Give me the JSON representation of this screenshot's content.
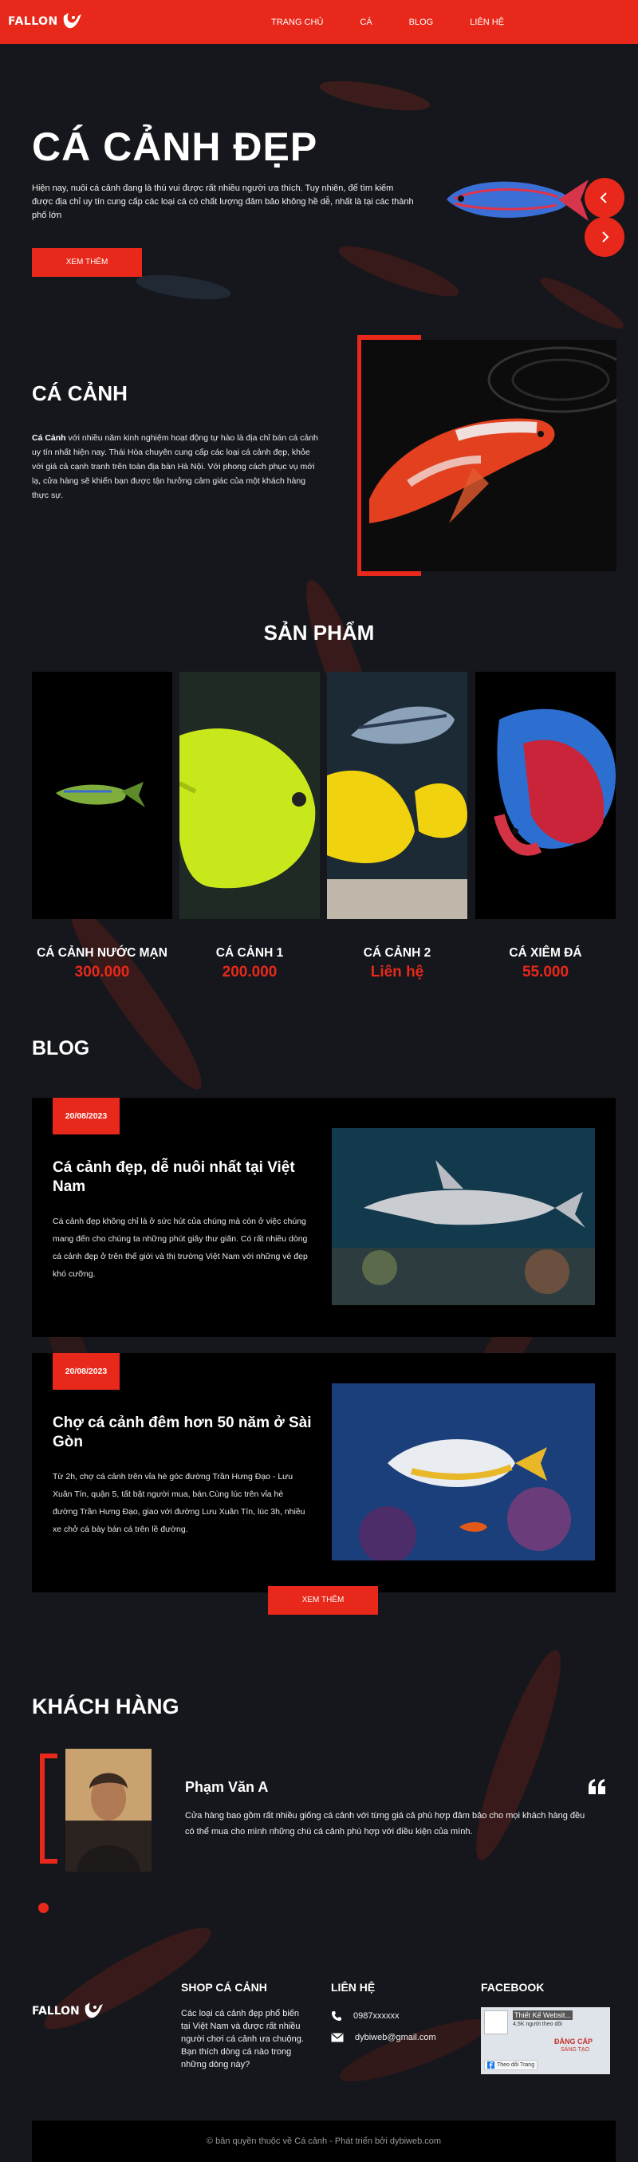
{
  "header": {
    "logo_text": "FALLON",
    "nav": [
      "TRANG CHỦ",
      "CÁ",
      "BLOG",
      "LIÊN HỆ"
    ]
  },
  "hero": {
    "title": "CÁ CẢNH ĐẸP",
    "description": "Hiện nay, nuôi cá cảnh đang là thú vui được rất nhiều người ưa thích. Tuy nhiên, để tìm kiếm được địa chỉ uy tín cung cấp các loại cá có chất lượng đảm bảo không hề dễ, nhất là tại các thành phố lớn",
    "button": "XEM THÊM",
    "prev_icon": "chevron-left-icon",
    "next_icon": "chevron-right-icon"
  },
  "about": {
    "title": "CÁ CẢNH",
    "text_bold": "Cá Cảnh",
    "text": " với nhiều năm kinh nghiệm hoạt động tự hào là địa chỉ bán cá cảnh uy tín nhất hiện nay. Thái Hòa chuyên cung cấp các loại cá cảnh đẹp, khỏe với giá cả cạnh tranh trên toàn địa bàn Hà Nội. Với phong cách phục vụ mới lạ, cửa hàng sẽ khiến bạn được tận hưởng cảm giác của một khách hàng thực sự."
  },
  "products": {
    "title": "SẢN PHẨM",
    "items": [
      {
        "name": "CÁ CẢNH NƯỚC MẠN",
        "price": "300.000"
      },
      {
        "name": "CÁ CẢNH 1",
        "price": "200.000"
      },
      {
        "name": "CÁ CẢNH 2",
        "price": "Liên hệ"
      },
      {
        "name": "CÁ XIÊM ĐÁ",
        "price": "55.000"
      }
    ]
  },
  "blog": {
    "title": "BLOG",
    "posts": [
      {
        "date": "20/08/2023",
        "title": "Cá cảnh đẹp, dễ nuôi nhất tại Việt Nam",
        "body": "Cá cảnh đẹp không chỉ là ở sức hút của chúng mà còn ở việc chúng mang đến cho chúng ta những phút giây thư giãn. Có rất nhiều dòng cá cảnh đẹp ở trên thế giới và thị trường Việt Nam với những vẻ đẹp khó cưỡng."
      },
      {
        "date": "20/08/2023",
        "title": "Chợ cá cảnh đêm hơn 50 năm ở Sài Gòn",
        "body": "Từ 2h, chợ cá cảnh trên vỉa hè góc đường Trần Hưng Đạo - Lưu Xuân Tín, quận 5, tất bật người mua, bán.Cùng lúc trên vỉa hè đường Trần Hưng Đạo, giao với đường Lưu Xuân Tín, lúc 3h, nhiều xe chở cá bày bán cá trên lề đường."
      }
    ],
    "more_button": "XEM THÊM"
  },
  "customers": {
    "title": "KHÁCH HÀNG",
    "name": "Phạm Văn A",
    "quote_icon": "quote-icon",
    "text": "Cửa hàng bao gồm rất nhiều giống cá cảnh với từng giá cả phù hợp đảm bảo cho mọi khách hàng đều có thể mua cho mình những chú cá cảnh phù hợp với điều kiện của mình."
  },
  "footer": {
    "logo_text": "FALLON",
    "shop_title": "SHOP CÁ CẢNH",
    "shop_text": "Các loại cá cảnh đẹp phổ biến tại Việt Nam và được rất nhiều người chơi cá cảnh ưa chuộng. Bạn thích dòng cá nào trong những dòng này?",
    "contact_title": "LIÊN HỆ",
    "phone": "0987xxxxxx",
    "email": "dybiweb@gmail.com",
    "facebook_title": "FACEBOOK",
    "fb_page_name": "Thiết Kế Websit...",
    "fb_followers": "4,5K người theo dõi",
    "fb_banner": "ĐẲNG CẤP",
    "fb_banner_sub": "SÁNG TẠO",
    "fb_follow": "Theo dõi Trang",
    "copyright": "© bản quyền thuộc về Cá cảnh - Phát triển bởi dybiweb.com"
  },
  "colors": {
    "accent": "#e8281a",
    "background": "#15171c",
    "card": "#000000"
  }
}
